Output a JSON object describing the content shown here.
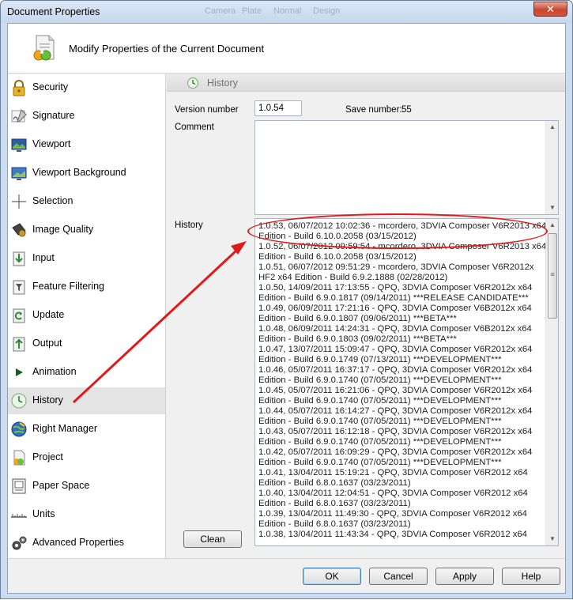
{
  "window": {
    "title": "Document Properties",
    "ghost_titles": [
      "Camera",
      "Plate",
      "Normal",
      "Design"
    ],
    "close_glyph": "✕"
  },
  "header": {
    "title": "Modify Properties of the Current Document",
    "icon": "document-properties-icon"
  },
  "sidebar": {
    "items": [
      {
        "label": "Security",
        "icon": "lock-icon"
      },
      {
        "label": "Signature",
        "icon": "signature-pen-icon"
      },
      {
        "label": "Viewport",
        "icon": "viewport-icon"
      },
      {
        "label": "Viewport Background",
        "icon": "viewport-background-icon"
      },
      {
        "label": "Selection",
        "icon": "crosshair-icon"
      },
      {
        "label": "Image Quality",
        "icon": "camera-icon"
      },
      {
        "label": "Input",
        "icon": "input-arrow-icon"
      },
      {
        "label": "Feature Filtering",
        "icon": "filter-icon"
      },
      {
        "label": "Update",
        "icon": "update-icon"
      },
      {
        "label": "Output",
        "icon": "output-arrow-icon"
      },
      {
        "label": "Animation",
        "icon": "play-icon"
      },
      {
        "label": "History",
        "icon": "history-clock-icon",
        "selected": true
      },
      {
        "label": "Right Manager",
        "icon": "globe-rights-icon"
      },
      {
        "label": "Project",
        "icon": "project-icon"
      },
      {
        "label": "Paper Space",
        "icon": "paper-space-icon"
      },
      {
        "label": "Units",
        "icon": "ruler-icon"
      },
      {
        "label": "Advanced Properties",
        "icon": "gears-icon"
      }
    ]
  },
  "panel": {
    "title": "History",
    "version_label": "Version number",
    "version_value": "1.0.54",
    "save_label": "Save number:",
    "save_value": "55",
    "comment_label": "Comment",
    "comment_value": "",
    "history_label": "History",
    "history": [
      "1.0.53, 06/07/2012 10:02:36 - mcordero, 3DVIA Composer V6R2013 x64",
      "Edition - Build 6.10.0.2058 (03/15/2012)",
      "1.0.52, 06/07/2012 09:59:54 - mcordero, 3DVIA Composer V6R2013 x64",
      "Edition - Build 6.10.0.2058 (03/15/2012)",
      "1.0.51, 06/07/2012 09:51:29 - mcordero, 3DVIA Composer V6R2012x",
      "HF2 x64 Edition - Build 6.9.2.1888 (02/28/2012)",
      "1.0.50, 14/09/2011 17:13:55 - QPQ, 3DVIA Composer V6R2012x x64",
      "Edition - Build 6.9.0.1817 (09/14/2011)   ***RELEASE CANDIDATE***",
      "1.0.49, 06/09/2011 17:21:16 - QPQ, 3DVIA Composer V6B2012x x64",
      "Edition - Build 6.9.0.1807 (09/06/2011)   ***BETA***",
      "1.0.48, 06/09/2011 14:24:31 - QPQ, 3DVIA Composer V6B2012x x64",
      "Edition - Build 6.9.0.1803 (09/02/2011)   ***BETA***",
      "1.0.47, 13/07/2011 15:09:47 - QPQ, 3DVIA Composer V6R2012x x64",
      "Edition - Build 6.9.0.1749 (07/13/2011)   ***DEVELOPMENT***",
      "1.0.46, 05/07/2011 16:37:17 - QPQ, 3DVIA Composer V6R2012x x64",
      "Edition - Build 6.9.0.1740 (07/05/2011)   ***DEVELOPMENT***",
      "1.0.45, 05/07/2011 16:21:06 - QPQ, 3DVIA Composer V6R2012x x64",
      "Edition - Build 6.9.0.1740 (07/05/2011)   ***DEVELOPMENT***",
      "1.0.44, 05/07/2011 16:14:27 - QPQ, 3DVIA Composer V6R2012x x64",
      "Edition - Build 6.9.0.1740 (07/05/2011)   ***DEVELOPMENT***",
      "1.0.43, 05/07/2011 16:12:18 - QPQ, 3DVIA Composer V6R2012x x64",
      "Edition - Build 6.9.0.1740 (07/05/2011)   ***DEVELOPMENT***",
      "1.0.42, 05/07/2011 16:09:29 - QPQ, 3DVIA Composer V6R2012x x64",
      "Edition - Build 6.9.0.1740 (07/05/2011)   ***DEVELOPMENT***",
      "1.0.41, 13/04/2011 15:19:21 - QPQ, 3DVIA Composer V6R2012 x64",
      "Edition - Build 6.8.0.1637 (03/23/2011)",
      "1.0.40, 13/04/2011 12:04:51 - QPQ, 3DVIA Composer V6R2012 x64",
      "Edition - Build 6.8.0.1637 (03/23/2011)",
      "1.0.39, 13/04/2011 11:49:30 - QPQ, 3DVIA Composer V6R2012 x64",
      "Edition - Build 6.8.0.1637 (03/23/2011)",
      "1.0.38, 13/04/2011 11:43:34 - QPQ, 3DVIA Composer V6R2012 x64"
    ],
    "clean_label": "Clean"
  },
  "buttons": {
    "ok": "OK",
    "cancel": "Cancel",
    "apply": "Apply",
    "help": "Help"
  },
  "scroll_glyphs": {
    "up": "▲",
    "down": "▼",
    "grip": "≡"
  },
  "colors": {
    "annotation": "#e11919",
    "selected_row": "#e4e4e4",
    "window_frame": "#c9dcf0"
  }
}
